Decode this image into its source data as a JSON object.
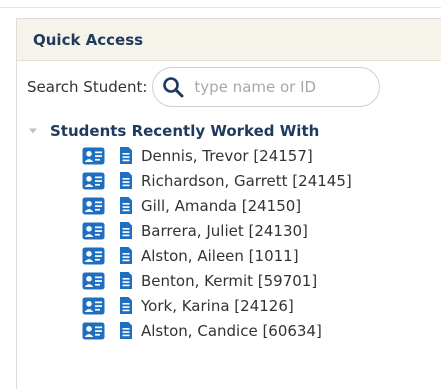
{
  "panel": {
    "title": "Quick Access"
  },
  "search": {
    "label": "Search Student:",
    "placeholder": "type name or ID"
  },
  "recent": {
    "title": "Students Recently Worked With",
    "students": [
      {
        "name": "Dennis, Trevor [24157]"
      },
      {
        "name": "Richardson, Garrett [24145]"
      },
      {
        "name": "Gill, Amanda [24150]"
      },
      {
        "name": "Barrera, Juliet [24130]"
      },
      {
        "name": "Alston, Aileen [1011]"
      },
      {
        "name": "Benton, Kermit [59701]"
      },
      {
        "name": "York, Karina [24126]"
      },
      {
        "name": "Alston, Candice [60634]"
      }
    ]
  },
  "icons": {
    "search": "search-icon",
    "toggle": "triangle-down-icon",
    "contact": "contact-card-icon",
    "document": "document-icon"
  },
  "colors": {
    "heading": "#1e3a5e",
    "icon_blue": "#1f6fc1",
    "header_bg": "#f6f3ea"
  }
}
